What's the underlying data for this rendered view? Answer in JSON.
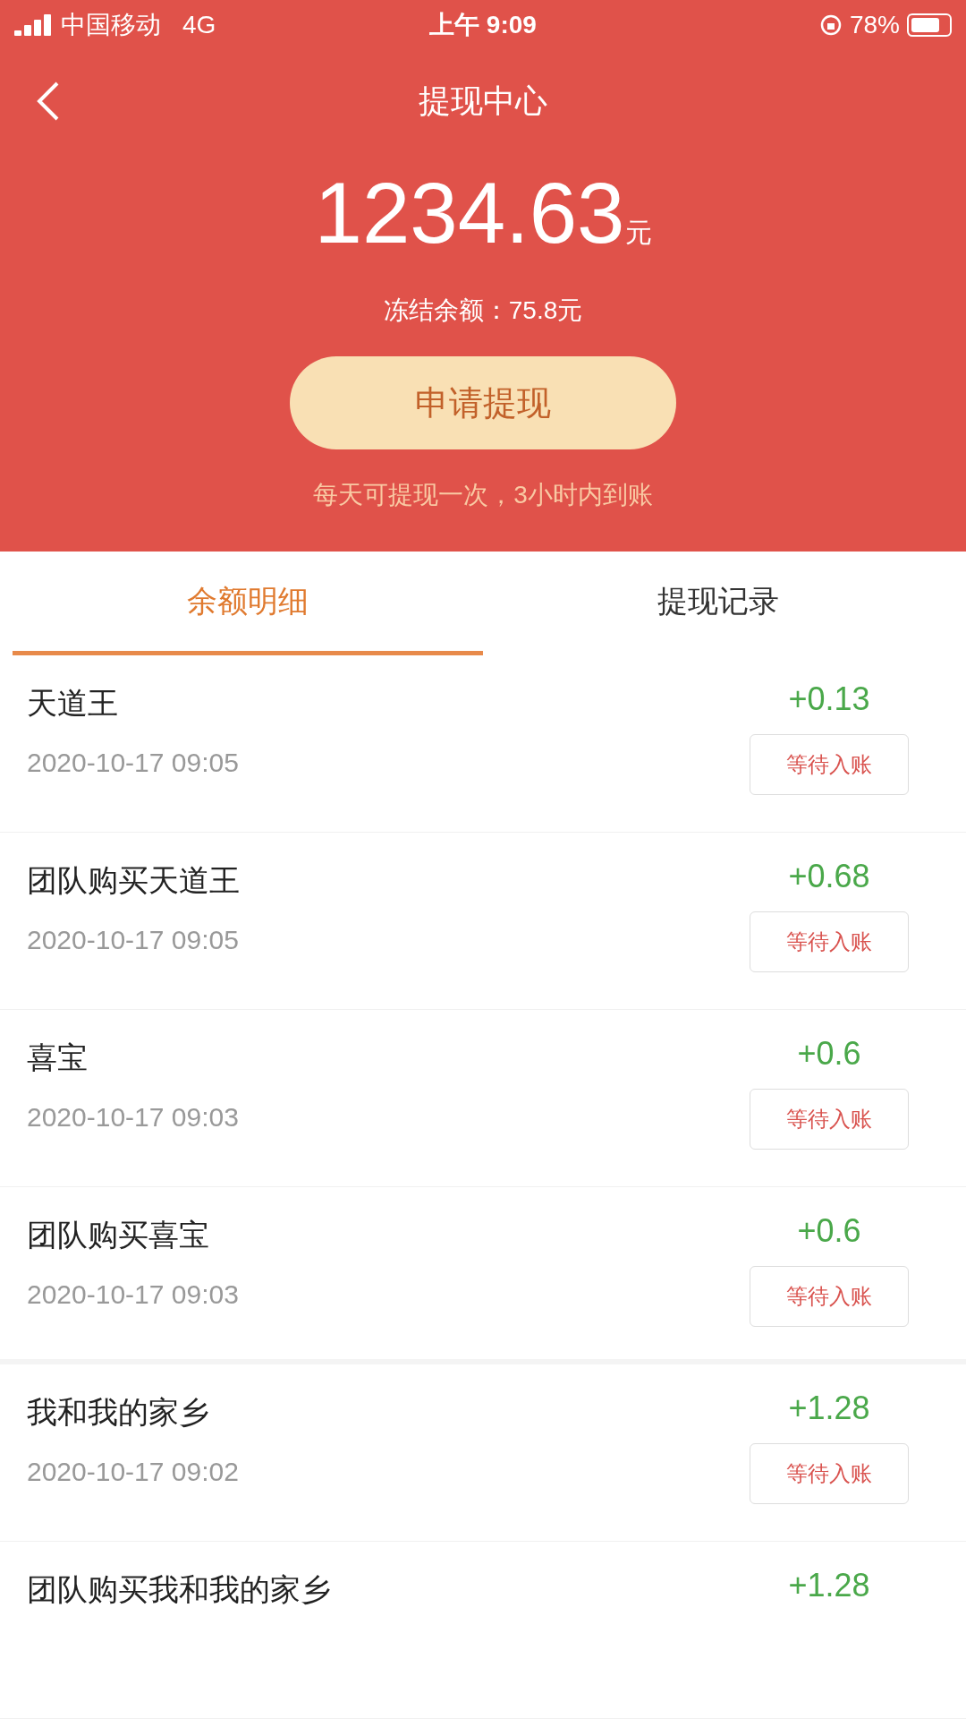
{
  "status_bar": {
    "carrier": "中国移动",
    "network": "4G",
    "time": "上午 9:09",
    "battery": "78%"
  },
  "nav": {
    "title": "提现中心"
  },
  "balance": {
    "amount": "1234.63",
    "unit": "元",
    "frozen": "冻结余额：75.8元",
    "button": "申请提现",
    "hint": "每天可提现一次，3小时内到账"
  },
  "tabs": [
    {
      "label": "余额明细",
      "selected": true
    },
    {
      "label": "提现记录",
      "selected": false
    }
  ],
  "records": [
    {
      "name": "天道王",
      "time": "2020-10-17 09:05",
      "amount": "+0.13",
      "status": "等待入账"
    },
    {
      "name": "团队购买天道王",
      "time": "2020-10-17 09:05",
      "amount": "+0.68",
      "status": "等待入账"
    },
    {
      "name": "喜宝",
      "time": "2020-10-17 09:03",
      "amount": "+0.6",
      "status": "等待入账"
    },
    {
      "name": "团队购买喜宝",
      "time": "2020-10-17 09:03",
      "amount": "+0.6",
      "status": "等待入账"
    },
    {
      "name": "我和我的家乡",
      "time": "2020-10-17 09:02",
      "amount": "+1.28",
      "status": "等待入账"
    },
    {
      "name": "团队购买我和我的家乡",
      "amount": "+1.28"
    }
  ]
}
